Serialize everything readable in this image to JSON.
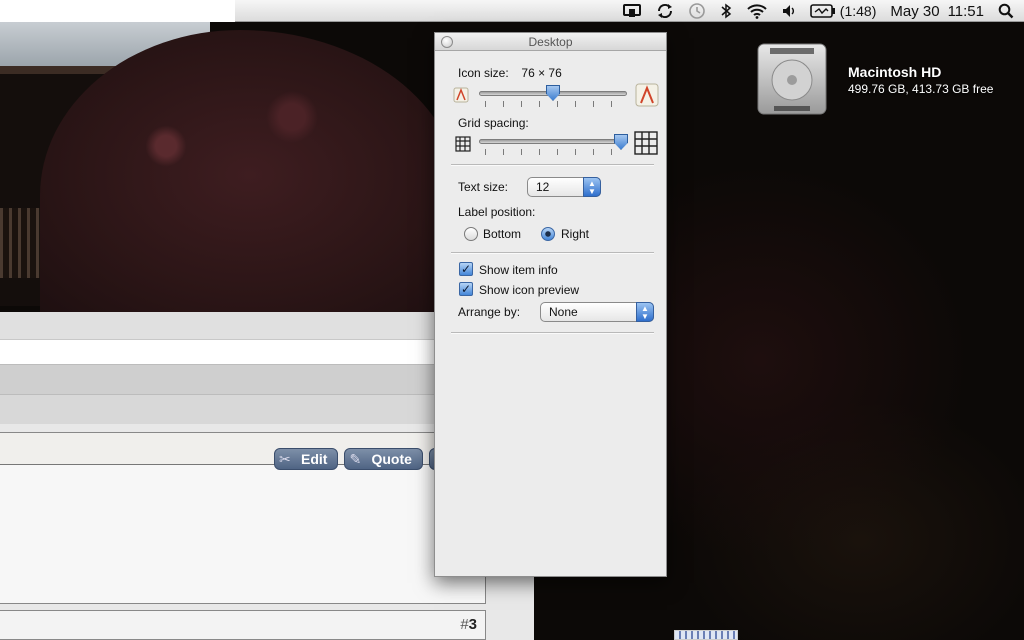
{
  "menubar": {
    "battery_time": "(1:48)",
    "date": "May 30",
    "time": "11:51",
    "icons": [
      "display-mirroring-icon",
      "sync-icon",
      "time-machine-icon",
      "bluetooth-icon",
      "wifi-icon",
      "volume-icon",
      "battery-icon",
      "spotlight-icon"
    ]
  },
  "desktop": {
    "drive_name": "Macintosh HD",
    "drive_info": "499.76 GB, 413.73 GB free"
  },
  "panel": {
    "title": "Desktop",
    "icon_size_label": "Icon size:",
    "icon_size_value": "76 × 76",
    "icon_size_level": 0.5,
    "grid_spacing_label": "Grid spacing:",
    "grid_spacing_level": 1.0,
    "text_size_label": "Text size:",
    "text_size_value": "12",
    "label_position_label": "Label position:",
    "label_position_options": [
      "Bottom",
      "Right"
    ],
    "label_position_selected": "Right",
    "show_item_info_label": "Show item info",
    "show_item_info_checked": true,
    "show_icon_preview_label": "Show icon preview",
    "show_icon_preview_checked": true,
    "arrange_by_label": "Arrange by:",
    "arrange_by_value": "None"
  },
  "background_window": {
    "edit_label": "Edit",
    "quote_label": "Quote",
    "post_number_hash": "#",
    "post_number": "3"
  },
  "colors": {
    "menubar": "#e9e9e9",
    "panel": "#ececec",
    "accent": "#3f7fd0",
    "forum_button": "#5a6f90"
  }
}
